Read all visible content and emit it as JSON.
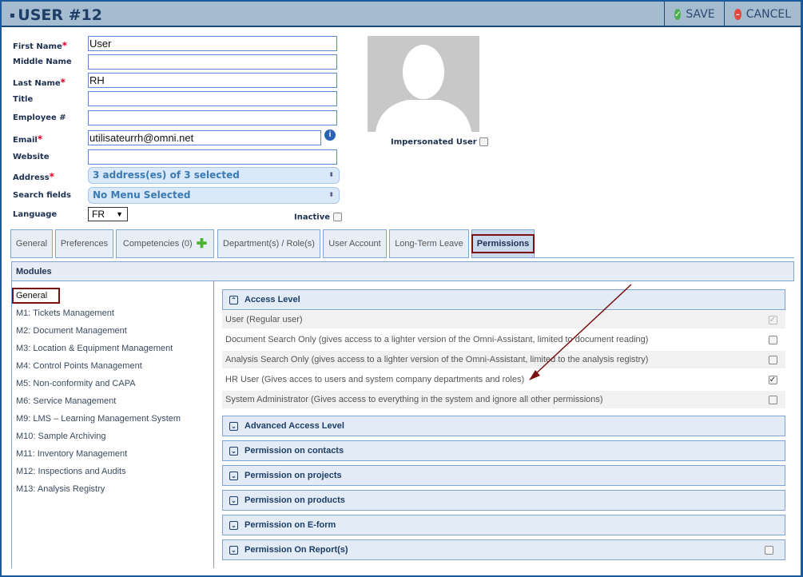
{
  "header": {
    "title": "USER #12",
    "save": "SAVE",
    "cancel": "CANCEL"
  },
  "form": {
    "first_name": {
      "label": "First Name",
      "value": "User"
    },
    "middle_name": {
      "label": "Middle Name",
      "value": ""
    },
    "last_name": {
      "label": "Last Name",
      "value": "RH"
    },
    "title": {
      "label": "Title",
      "value": ""
    },
    "employee": {
      "label": "Employee #",
      "value": ""
    },
    "email": {
      "label": "Email",
      "value": "utilisateurrh@omni.net"
    },
    "website": {
      "label": "Website",
      "value": ""
    },
    "address": {
      "label": "Address",
      "value": "3 address(es) of 3 selected"
    },
    "search_fields": {
      "label": "Search fields",
      "value": "No Menu Selected"
    },
    "language": {
      "label": "Language",
      "value": "FR"
    },
    "inactive": "Inactive",
    "impersonated": "Impersonated User"
  },
  "tabs": [
    "General",
    "Preferences",
    "Competencies (0)",
    "Department(s) / Role(s)",
    "User Account",
    "Long-Term Leave",
    "Permissions"
  ],
  "modules": {
    "title": "Modules",
    "items": [
      "General",
      "M1: Tickets Management",
      "M2: Document Management",
      "M3: Location & Equipment Management",
      "M4: Control Points Management",
      "M5: Non-conformity and CAPA",
      "M6: Service Management",
      "M9: LMS – Learning Management System",
      "M10: Sample Archiving",
      "M11: Inventory Management",
      "M12: Inspections and Audits",
      "M13: Analysis Registry"
    ]
  },
  "access_level": {
    "title": "Access Level",
    "rows": [
      {
        "label": "User (Regular user)",
        "checked": true,
        "disabled": true
      },
      {
        "label": "Document Search Only (gives access to a lighter version of the Omni-Assistant, limited to document reading)",
        "checked": false
      },
      {
        "label": "Analysis Search Only (gives access to a lighter version of the Omni-Assistant, limited to the analysis registry)",
        "checked": false
      },
      {
        "label": "HR User (Gives acces to users and system company departments and roles)",
        "checked": true
      },
      {
        "label": "System Administrator (Gives access to everything in the system and ignore all other permissions)",
        "checked": false
      }
    ]
  },
  "sections": [
    "Advanced Access Level",
    "Permission on contacts",
    "Permission on projects",
    "Permission on products",
    "Permission on E-form",
    "Permission On Report(s)"
  ],
  "colors": {
    "annotation": "#7a1010",
    "header_bg": "#a5bbd0"
  }
}
